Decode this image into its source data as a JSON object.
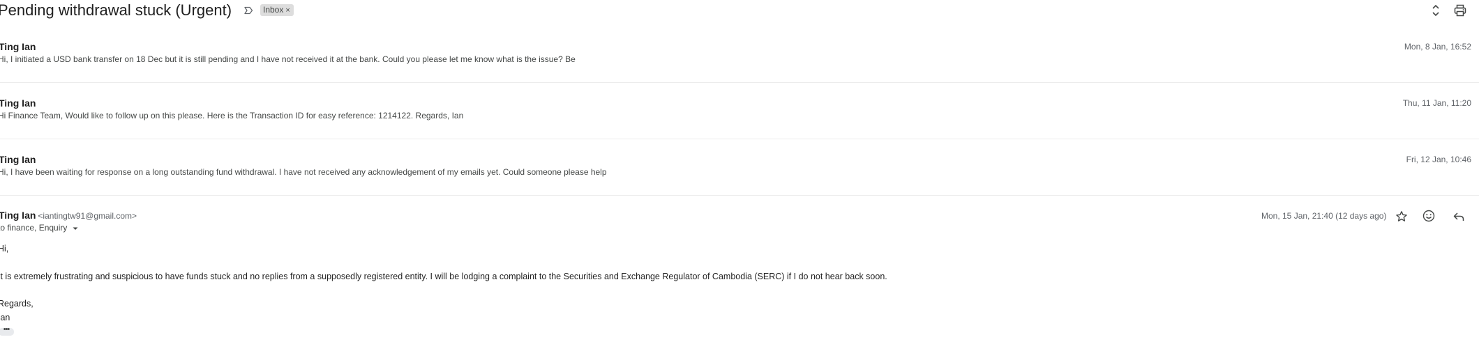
{
  "thread": {
    "subject": "Pending withdrawal stuck (Urgent)",
    "label": "Inbox",
    "label_remove": "×"
  },
  "messages": [
    {
      "sender": "Ting Ian",
      "snippet": "Hi, I initiated a USD bank transfer on 18 Dec but it is still pending and I have not received it at the bank. Could you please let me know what is the issue? Be",
      "date": "Mon, 8 Jan, 16:52"
    },
    {
      "sender": "Ting Ian",
      "snippet": "Hi Finance Team, Would like to follow up on this please. Here is the Transaction ID for easy reference: 1214122. Regards, Ian",
      "date": "Thu, 11 Jan, 11:20"
    },
    {
      "sender": "Ting Ian",
      "snippet": "Hi, I have been waiting for response on a long outstanding fund withdrawal. I have not received any acknowledgement of my emails yet. Could someone please help",
      "date": "Fri, 12 Jan, 10:46"
    }
  ],
  "open_message": {
    "sender": "Ting Ian",
    "sender_email": "<iantingtw91@gmail.com>",
    "recipients": "to finance, Enquiry",
    "date": "Mon, 15 Jan, 21:40 (12 days ago)",
    "body": {
      "greeting": "Hi,",
      "paragraph": "It is extremely frustrating and suspicious to have funds stuck and no replies from a supposedly registered entity. I will be lodging a complaint to the Securities and Exchange Regulator of Cambodia (SERC) if I do not hear back soon.",
      "signoff": "Regards,",
      "signature": "Ian",
      "trimmed_content": "•••"
    }
  },
  "icons": {
    "important": "important-marker-icon",
    "expand": "expand-all-icon",
    "print": "print-icon",
    "star": "star-icon",
    "emoji": "emoji-reaction-icon",
    "reply": "reply-icon",
    "caret": "chevron-down-icon"
  }
}
